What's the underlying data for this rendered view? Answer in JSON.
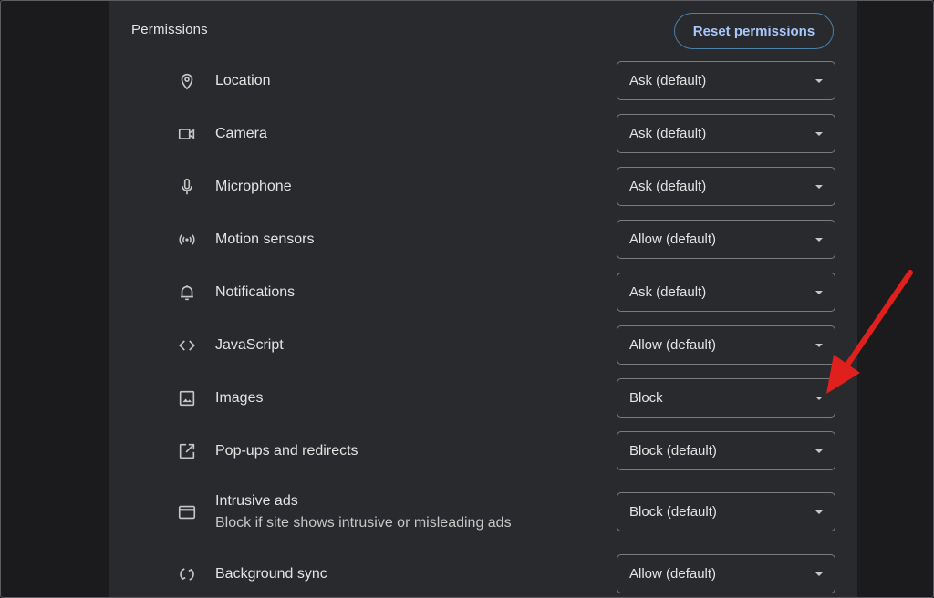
{
  "section": {
    "title": "Permissions",
    "reset_label": "Reset permissions"
  },
  "permissions": [
    {
      "label": "Location",
      "value": "Ask (default)",
      "icon": "location-pin-icon"
    },
    {
      "label": "Camera",
      "value": "Ask (default)",
      "icon": "camera-icon"
    },
    {
      "label": "Microphone",
      "value": "Ask (default)",
      "icon": "microphone-icon"
    },
    {
      "label": "Motion sensors",
      "value": "Allow (default)",
      "icon": "sensors-icon"
    },
    {
      "label": "Notifications",
      "value": "Ask (default)",
      "icon": "bell-icon"
    },
    {
      "label": "JavaScript",
      "value": "Allow (default)",
      "icon": "code-icon"
    },
    {
      "label": "Images",
      "value": "Block",
      "icon": "image-icon"
    },
    {
      "label": "Pop-ups and redirects",
      "value": "Block (default)",
      "icon": "open-external-icon"
    },
    {
      "label": "Intrusive ads",
      "sublabel": "Block if site shows intrusive or misleading ads",
      "value": "Block (default)",
      "icon": "browser-window-icon"
    },
    {
      "label": "Background sync",
      "value": "Allow (default)",
      "icon": "sync-icon"
    }
  ],
  "colors": {
    "background": "#1b1b1d",
    "panel": "#292a2d",
    "text": "#e3e3e3",
    "accent": "#a8c7fa",
    "annotation_arrow": "#e0201d"
  }
}
